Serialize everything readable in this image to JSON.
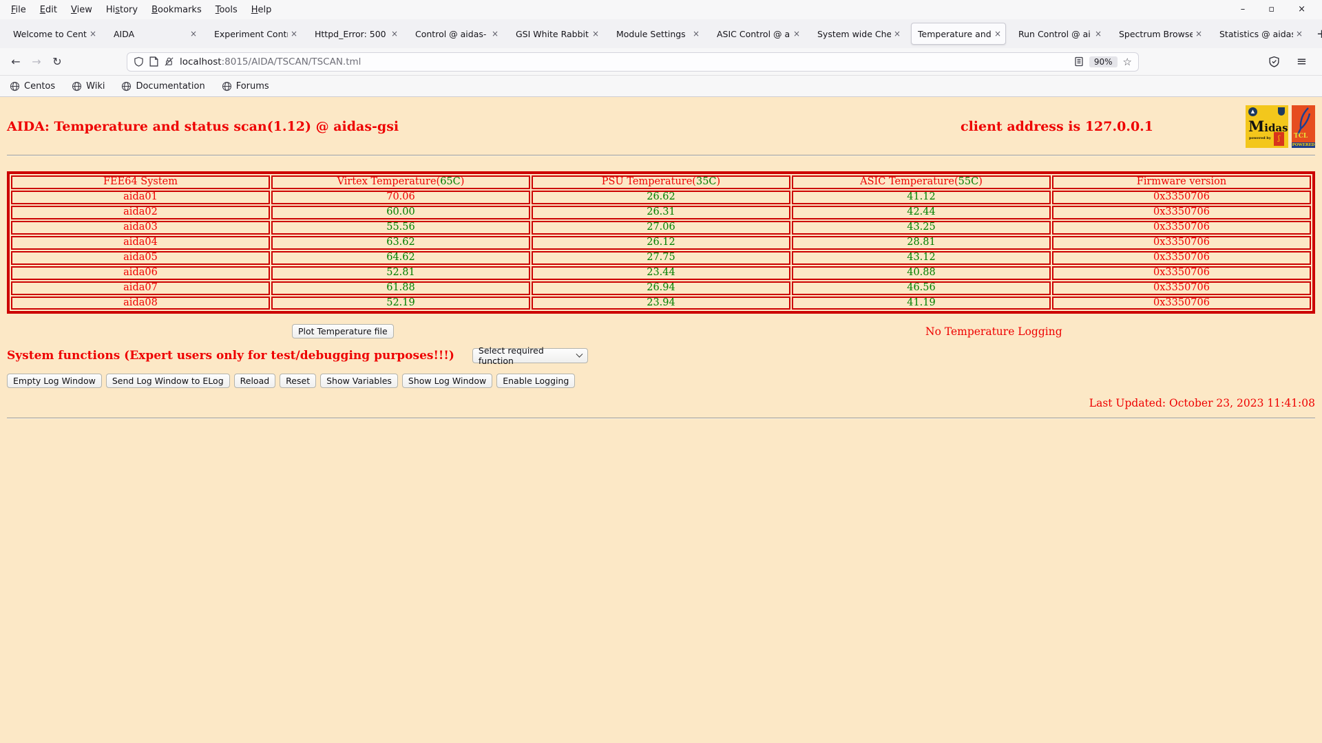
{
  "browser": {
    "menu": [
      {
        "label": "File",
        "pre": "",
        "key": "F",
        "post": "ile"
      },
      {
        "label": "Edit",
        "pre": "",
        "key": "E",
        "post": "dit"
      },
      {
        "label": "View",
        "pre": "",
        "key": "V",
        "post": "iew"
      },
      {
        "label": "History",
        "pre": "Hi",
        "key": "s",
        "post": "tory"
      },
      {
        "label": "Bookmarks",
        "pre": "",
        "key": "B",
        "post": "ookmarks"
      },
      {
        "label": "Tools",
        "pre": "",
        "key": "T",
        "post": "ools"
      },
      {
        "label": "Help",
        "pre": "",
        "key": "H",
        "post": "elp"
      }
    ],
    "window_controls": [
      {
        "name": "minimize",
        "glyph": "–"
      },
      {
        "name": "maximize",
        "glyph": "▫"
      },
      {
        "name": "close",
        "glyph": "×"
      }
    ],
    "tabs": [
      {
        "label": "Welcome to Cent",
        "active": false
      },
      {
        "label": "AIDA",
        "active": false
      },
      {
        "label": "Experiment Contr",
        "active": false
      },
      {
        "label": "Httpd_Error: 500",
        "active": false
      },
      {
        "label": "Control @ aidas-",
        "active": false
      },
      {
        "label": "GSI White Rabbit",
        "active": false
      },
      {
        "label": "Module Settings",
        "active": false
      },
      {
        "label": "ASIC Control @ a",
        "active": false
      },
      {
        "label": "System wide Che",
        "active": false
      },
      {
        "label": "Temperature and",
        "active": true
      },
      {
        "label": "Run Control @ ai",
        "active": false
      },
      {
        "label": "Spectrum Browse",
        "active": false
      },
      {
        "label": "Statistics @ aidas",
        "active": false
      }
    ],
    "new_tab": "+",
    "icons": {
      "back": "←",
      "forward": "→",
      "reload": "↻",
      "star": "☆",
      "menu": "≡",
      "close": "×"
    },
    "url": {
      "host": "localhost",
      "path": ":8015/AIDA/TSCAN/TSCAN.tml"
    },
    "zoom_level": "90%",
    "bookmarks": [
      "Centos",
      "Wiki",
      "Documentation",
      "Forums"
    ]
  },
  "page": {
    "title": "AIDA: Temperature and status scan(1.12) @ aidas-gsi",
    "client_address": "client address is 127.0.0.1",
    "logos": {
      "midas_text": "Midas",
      "midas_big_letter": "M",
      "midas_rest": "idas",
      "midas_powered": "powered by",
      "tcl_text": "TCL",
      "tcl_powered": "POWERED"
    },
    "table": {
      "headers": [
        {
          "pre": "FEE64 System",
          "limit": "",
          "post": ""
        },
        {
          "pre": "Virtex Temperature(",
          "limit": "65C",
          "post": ")"
        },
        {
          "pre": "PSU Temperature(",
          "limit": "35C",
          "post": ")"
        },
        {
          "pre": "ASIC Temperature(",
          "limit": "55C",
          "post": ")"
        },
        {
          "pre": "Firmware version",
          "limit": "",
          "post": ""
        }
      ],
      "rows": [
        [
          {
            "text": "aida01",
            "color": "red"
          },
          {
            "text": "70.06",
            "color": "red"
          },
          {
            "text": "26.62",
            "color": "green"
          },
          {
            "text": "41.12",
            "color": "green"
          },
          {
            "text": "0x3350706",
            "color": "red"
          }
        ],
        [
          {
            "text": "aida02",
            "color": "red"
          },
          {
            "text": "60.00",
            "color": "green"
          },
          {
            "text": "26.31",
            "color": "green"
          },
          {
            "text": "42.44",
            "color": "green"
          },
          {
            "text": "0x3350706",
            "color": "red"
          }
        ],
        [
          {
            "text": "aida03",
            "color": "red"
          },
          {
            "text": "55.56",
            "color": "green"
          },
          {
            "text": "27.06",
            "color": "green"
          },
          {
            "text": "43.25",
            "color": "green"
          },
          {
            "text": "0x3350706",
            "color": "red"
          }
        ],
        [
          {
            "text": "aida04",
            "color": "red"
          },
          {
            "text": "63.62",
            "color": "green"
          },
          {
            "text": "26.12",
            "color": "green"
          },
          {
            "text": "28.81",
            "color": "green"
          },
          {
            "text": "0x3350706",
            "color": "red"
          }
        ],
        [
          {
            "text": "aida05",
            "color": "red"
          },
          {
            "text": "64.62",
            "color": "green"
          },
          {
            "text": "27.75",
            "color": "green"
          },
          {
            "text": "43.12",
            "color": "green"
          },
          {
            "text": "0x3350706",
            "color": "red"
          }
        ],
        [
          {
            "text": "aida06",
            "color": "red"
          },
          {
            "text": "52.81",
            "color": "green"
          },
          {
            "text": "23.44",
            "color": "green"
          },
          {
            "text": "40.88",
            "color": "green"
          },
          {
            "text": "0x3350706",
            "color": "red"
          }
        ],
        [
          {
            "text": "aida07",
            "color": "red"
          },
          {
            "text": "61.88",
            "color": "green"
          },
          {
            "text": "26.94",
            "color": "green"
          },
          {
            "text": "46.56",
            "color": "green"
          },
          {
            "text": "0x3350706",
            "color": "red"
          }
        ],
        [
          {
            "text": "aida08",
            "color": "red"
          },
          {
            "text": "52.19",
            "color": "green"
          },
          {
            "text": "23.94",
            "color": "green"
          },
          {
            "text": "41.19",
            "color": "green"
          },
          {
            "text": "0x3350706",
            "color": "red"
          }
        ]
      ]
    },
    "plot_button": "Plot Temperature file",
    "no_logging": "No Temperature Logging",
    "system_functions_label": "System functions (Expert users only for test/debugging purposes!!!)",
    "select_placeholder": "Select required function",
    "action_buttons": [
      "Empty Log Window",
      "Send Log Window to ELog",
      "Reload",
      "Reset",
      "Show Variables",
      "Show Log Window",
      "Enable Logging"
    ],
    "last_updated": "Last Updated: October 23, 2023 11:41:08",
    "colors": {
      "page_background": "#fce8c6",
      "alert_red": "#ee0000",
      "ok_green": "#007f00",
      "table_border_red": "#cc0000",
      "midas_yellow": "#f3c71c",
      "tcl_orange": "#e64d1f"
    }
  }
}
